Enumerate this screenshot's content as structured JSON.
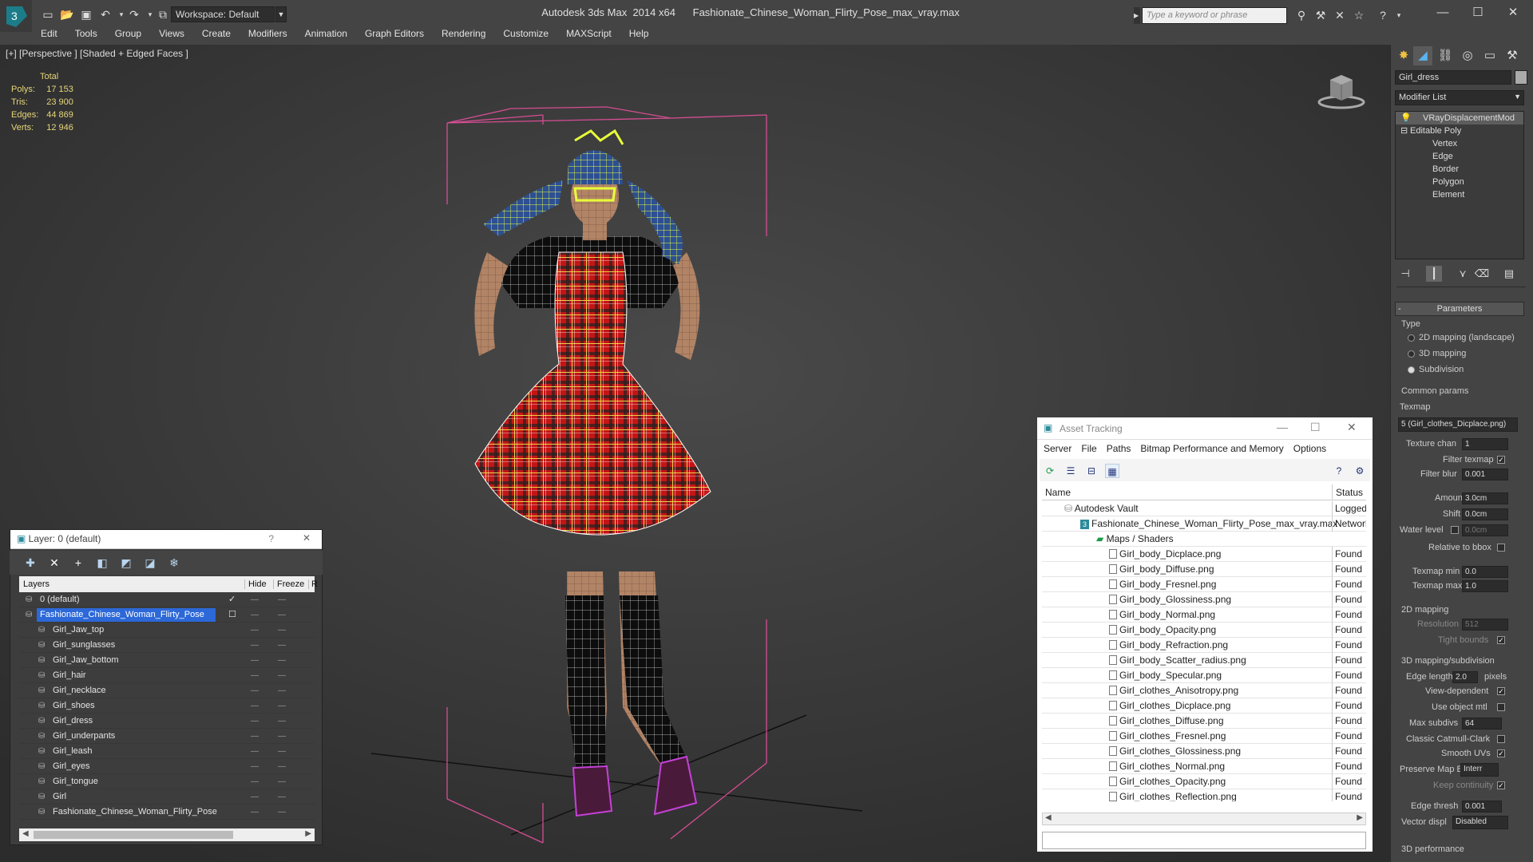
{
  "app": {
    "title": "Autodesk 3ds Max  2014 x64",
    "file": "Fashionate_Chinese_Woman_Flirty_Pose_max_vray.max",
    "workspace": "Workspace: Default",
    "search_placeholder": "Type a keyword or phrase"
  },
  "menu": [
    "Edit",
    "Tools",
    "Group",
    "Views",
    "Create",
    "Modifiers",
    "Animation",
    "Graph Editors",
    "Rendering",
    "Customize",
    "MAXScript",
    "Help"
  ],
  "viewport": {
    "label": "[+] [Perspective ] [Shaded + Edged Faces ]",
    "stats_header": "Total",
    "stats": [
      {
        "label": "Polys:",
        "value": "17 153"
      },
      {
        "label": "Tris:",
        "value": "23 900"
      },
      {
        "label": "Edges:",
        "value": "44 869"
      },
      {
        "label": "Verts:",
        "value": "12 946"
      }
    ]
  },
  "layer_panel": {
    "title": "Layer: 0 (default)",
    "help": "?",
    "close": "✕",
    "columns": {
      "layers": "Layers",
      "hide": "Hide",
      "freeze": "Freeze",
      "r": "R"
    },
    "rows": [
      {
        "name": "0 (default)",
        "indent": 1,
        "check": "✓"
      },
      {
        "name": "Fashionate_Chinese_Woman_Flirty_Pose",
        "indent": 1,
        "selected": true,
        "check": "☐"
      },
      {
        "name": "Girl_Jaw_top",
        "indent": 2
      },
      {
        "name": "Girl_sunglasses",
        "indent": 2
      },
      {
        "name": "Girl_Jaw_bottom",
        "indent": 2
      },
      {
        "name": "Girl_hair",
        "indent": 2
      },
      {
        "name": "Girl_necklace",
        "indent": 2
      },
      {
        "name": "Girl_shoes",
        "indent": 2
      },
      {
        "name": "Girl_dress",
        "indent": 2
      },
      {
        "name": "Girl_underpants",
        "indent": 2
      },
      {
        "name": "Girl_leash",
        "indent": 2
      },
      {
        "name": "Girl_eyes",
        "indent": 2
      },
      {
        "name": "Girl_tongue",
        "indent": 2
      },
      {
        "name": "Girl",
        "indent": 2
      },
      {
        "name": "Fashionate_Chinese_Woman_Flirty_Pose",
        "indent": 2
      }
    ]
  },
  "asset_panel": {
    "title": "Asset Tracking",
    "menu": [
      "Server",
      "File",
      "Paths",
      "Bitmap Performance and Memory",
      "Options"
    ],
    "columns": {
      "name": "Name",
      "status": "Status"
    },
    "rows": [
      {
        "name": "Autodesk Vault",
        "status": "Logged Out",
        "indent": 1
      },
      {
        "name": "Fashionate_Chinese_Woman_Flirty_Pose_max_vray.max",
        "status": "Network",
        "indent": 2
      },
      {
        "name": "Maps / Shaders",
        "status": "",
        "indent": 3
      },
      {
        "name": "Girl_body_Dicplace.png",
        "status": "Found",
        "indent": 4
      },
      {
        "name": "Girl_body_Diffuse.png",
        "status": "Found",
        "indent": 4
      },
      {
        "name": "Girl_body_Fresnel.png",
        "status": "Found",
        "indent": 4
      },
      {
        "name": "Girl_body_Glossiness.png",
        "status": "Found",
        "indent": 4
      },
      {
        "name": "Girl_body_Normal.png",
        "status": "Found",
        "indent": 4
      },
      {
        "name": "Girl_body_Opacity.png",
        "status": "Found",
        "indent": 4
      },
      {
        "name": "Girl_body_Refraction.png",
        "status": "Found",
        "indent": 4
      },
      {
        "name": "Girl_body_Scatter_radius.png",
        "status": "Found",
        "indent": 4
      },
      {
        "name": "Girl_body_Specular.png",
        "status": "Found",
        "indent": 4
      },
      {
        "name": "Girl_clothes_Anisotropy.png",
        "status": "Found",
        "indent": 4
      },
      {
        "name": "Girl_clothes_Dicplace.png",
        "status": "Found",
        "indent": 4
      },
      {
        "name": "Girl_clothes_Diffuse.png",
        "status": "Found",
        "indent": 4
      },
      {
        "name": "Girl_clothes_Fresnel.png",
        "status": "Found",
        "indent": 4
      },
      {
        "name": "Girl_clothes_Glossiness.png",
        "status": "Found",
        "indent": 4
      },
      {
        "name": "Girl_clothes_Normal.png",
        "status": "Found",
        "indent": 4
      },
      {
        "name": "Girl_clothes_Opacity.png",
        "status": "Found",
        "indent": 4
      },
      {
        "name": "Girl_clothes_Reflection.png",
        "status": "Found",
        "indent": 4
      }
    ]
  },
  "command_panel": {
    "object_name": "Girl_dress",
    "modifier_list": "Modifier List",
    "stack": [
      {
        "name": "VRayDisplacementMod",
        "level": 0
      },
      {
        "name": "Editable Poly",
        "level": 0
      },
      {
        "name": "Vertex",
        "level": 1
      },
      {
        "name": "Edge",
        "level": 1
      },
      {
        "name": "Border",
        "level": 1
      },
      {
        "name": "Polygon",
        "level": 1
      },
      {
        "name": "Element",
        "level": 1
      }
    ],
    "params": {
      "rollout": "Parameters",
      "type_label": "Type",
      "type_options": [
        "2D mapping (landscape)",
        "3D mapping",
        "Subdivision"
      ],
      "type_selected": 2,
      "common_params": "Common params",
      "texmap_label": "Texmap",
      "texmap_value": "5 (Girl_clothes_Dicplace.png)",
      "texture_chan_label": "Texture chan",
      "texture_chan": "1",
      "filter_texmap": "Filter texmap",
      "filter_blur_label": "Filter blur",
      "filter_blur": "0.001",
      "amount_label": "Amount",
      "amount": "3.0cm",
      "shift_label": "Shift",
      "shift": "0.0cm",
      "water_level_label": "Water level",
      "water_level": "0.0cm",
      "relative_bbox": "Relative to bbox",
      "texmap_min_label": "Texmap min",
      "texmap_min": "0.0",
      "texmap_max_label": "Texmap max",
      "texmap_max": "1.0",
      "mapping2d": "2D mapping",
      "resolution_label": "Resolution",
      "resolution": "512",
      "tight_bounds": "Tight bounds",
      "mapping3d": "3D mapping/subdivision",
      "edge_length_label": "Edge length",
      "edge_length": "2.0",
      "pixels": "pixels",
      "view_dependent": "View-dependent",
      "use_object_mtl": "Use object mtl",
      "max_subdivs_label": "Max subdivs",
      "max_subdivs": "64",
      "classic_catmull": "Classic Catmull-Clark",
      "smooth_uvs": "Smooth UVs",
      "preserve_map_label": "Preserve Map Bnd",
      "preserve_map": "Interr",
      "keep_continuity": "Keep continuity",
      "edge_thresh_label": "Edge thresh",
      "edge_thresh": "0.001",
      "vector_displ_label": "Vector displ",
      "vector_displ": "Disabled",
      "perf3d": "3D performance"
    }
  }
}
